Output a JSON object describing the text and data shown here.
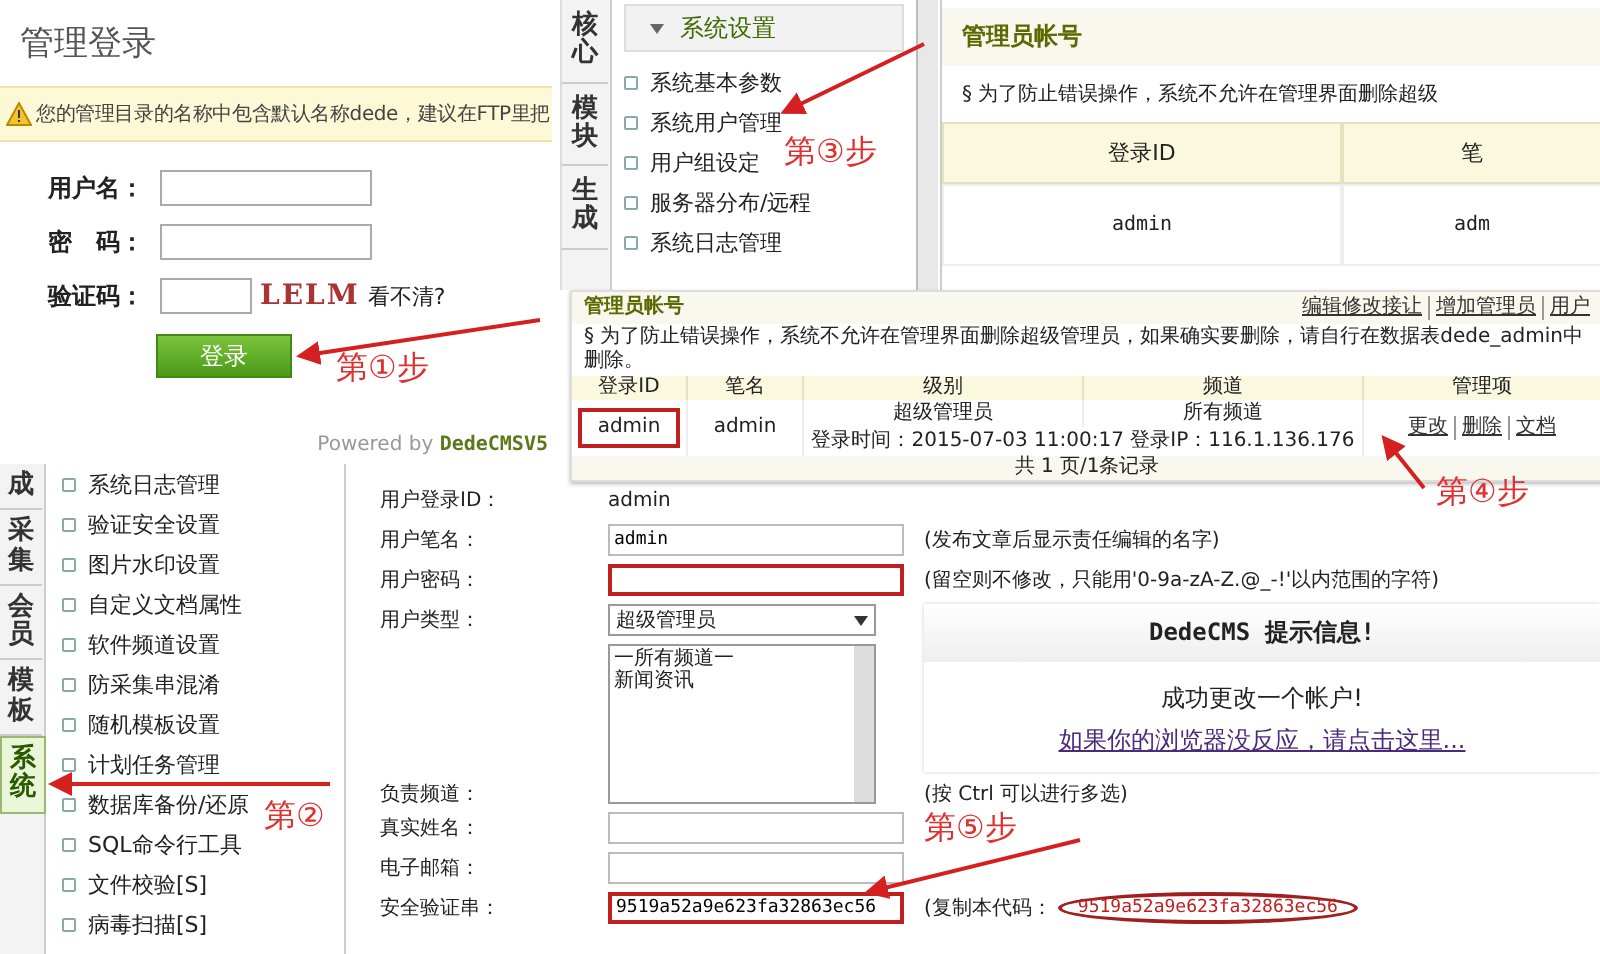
{
  "login": {
    "title": "管理登录",
    "warning": "您的管理目录的名称中包含默认名称dede，建议在FTP里把",
    "fields": [
      {
        "kind": "text",
        "label": "用户名："
      },
      {
        "kind": "text",
        "label": "密　码："
      },
      {
        "kind": "captcha",
        "label": "验证码：",
        "captcha": "LELM",
        "refresh": "看不清?"
      }
    ],
    "button": "登录",
    "powered_by": "Powered by",
    "brand": "DedeCMSV5"
  },
  "top_menu": {
    "side_tabs": [
      "核心",
      "模块",
      "生成"
    ],
    "header": "系统设置",
    "items": [
      "系统基本参数",
      "系统用户管理",
      "用户组设定",
      "服务器分布/远程",
      "系统日志管理"
    ]
  },
  "admin_panel": {
    "title": "管理员帐号",
    "notice": "§ 为了防止错误操作，系统不允许在管理界面删除超级",
    "columns": [
      "登录ID",
      "笔"
    ],
    "row": [
      "admin",
      "adm"
    ]
  },
  "admin_list": {
    "title": "管理员帐号",
    "links": [
      "编辑修改接让",
      "增加管理员",
      "用户"
    ],
    "notice": "§ 为了防止错误操作，系统不允许在管理界面删除超级管理员，如果确实要删除，请自行在数据表dede_admin中删除。",
    "columns": [
      "登录ID",
      "笔名",
      "级别",
      "频道",
      "管理项"
    ],
    "row": {
      "id": "admin",
      "id_marked": true,
      "pen_name": "admin",
      "level": "超级管理员",
      "channel": "所有频道",
      "login": "登录时间：2015-07-03 11:00:17 登录IP：116.1.136.176",
      "actions": [
        "更改",
        "删除",
        "文档"
      ]
    },
    "footer": "共 1 页/1条记录"
  },
  "bottom_menu": {
    "side_tabs": [
      {
        "label": "成",
        "selected": false
      },
      {
        "label": "采集",
        "selected": false
      },
      {
        "label": "会员",
        "selected": false
      },
      {
        "label": "模板",
        "selected": false
      },
      {
        "label": "系统",
        "selected": true
      }
    ],
    "items": [
      "系统日志管理",
      "验证安全设置",
      "图片水印设置",
      "自定义文档属性",
      "软件频道设置",
      "防采集串混淆",
      "随机模板设置",
      "计划任务管理",
      "数据库备份/还原",
      "SQL命令行工具",
      "文件校验[S]",
      "病毒扫描[S]"
    ]
  },
  "form": {
    "rows": [
      {
        "kind": "static",
        "label": "用户登录ID：",
        "value": "admin"
      },
      {
        "kind": "input",
        "label": "用户笔名：",
        "value": "admin",
        "marked": false,
        "hint": "(发布文章后显示责任编辑的名字)"
      },
      {
        "kind": "input",
        "label": "用户密码：",
        "marked": true,
        "hint": "(留空则不修改，只能用'0-9a-zA-Z.@_-!'以内范围的字符)"
      },
      {
        "kind": "select",
        "label": "用户类型：",
        "value": "超级管理员"
      },
      {
        "kind": "listbox",
        "label": "负责频道：",
        "options": [
          "一所有频道一",
          "新闻资讯"
        ],
        "hint": "(按 Ctrl 可以进行多选)"
      },
      {
        "kind": "input",
        "label": "真实姓名：",
        "marked": false
      },
      {
        "kind": "input",
        "label": "电子邮箱：",
        "marked": false
      },
      {
        "kind": "input",
        "label": "安全验证串：",
        "value": "9519a52a9e623fa32863ec56",
        "marked": true,
        "hint": "(复制本代码：",
        "code": "9519a52a9e623fa32863ec56"
      }
    ]
  },
  "message": {
    "title": "DedeCMS 提示信息!",
    "text": "成功更改一个帐户!",
    "link": "如果你的浏览器没反应，请点击这里..."
  },
  "steps": [
    "第①步",
    "第②",
    "第③步",
    "第④步",
    "第⑤步"
  ]
}
